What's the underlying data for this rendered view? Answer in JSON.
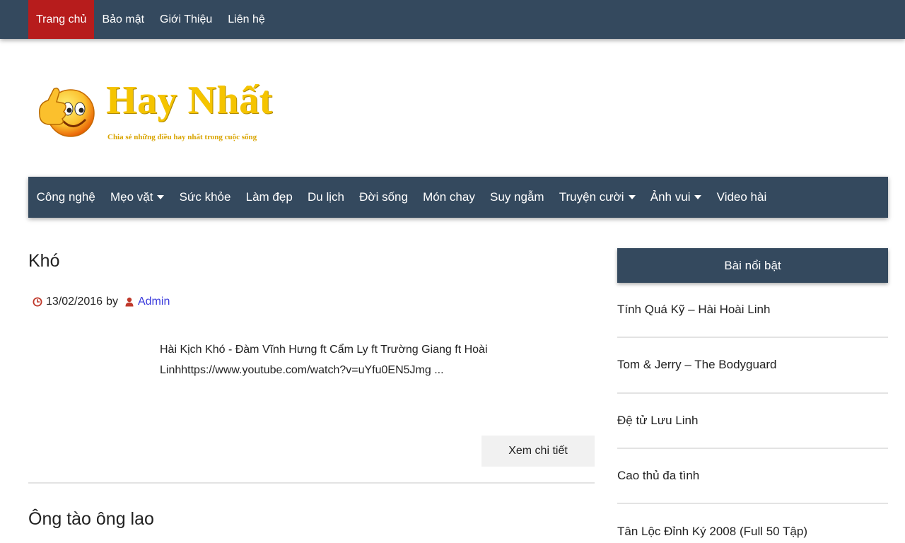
{
  "topnav": {
    "items": [
      {
        "label": "Trang chủ",
        "active": true
      },
      {
        "label": "Bảo mật"
      },
      {
        "label": "Giới Thiệu"
      },
      {
        "label": "Liên hệ"
      }
    ]
  },
  "logo": {
    "title": "Hay Nhất",
    "tagline": "Chia sẻ những điều hay nhất trong cuộc sống"
  },
  "mainnav": {
    "items": [
      {
        "label": "Công nghệ",
        "dropdown": false
      },
      {
        "label": "Mẹo vặt",
        "dropdown": true
      },
      {
        "label": "Sức khỏe",
        "dropdown": false
      },
      {
        "label": "Làm đẹp",
        "dropdown": false
      },
      {
        "label": "Du lịch",
        "dropdown": false
      },
      {
        "label": "Đời sống",
        "dropdown": false
      },
      {
        "label": "Món chay",
        "dropdown": false
      },
      {
        "label": "Suy ngẫm",
        "dropdown": false
      },
      {
        "label": "Truyện cười",
        "dropdown": true
      },
      {
        "label": "Ảnh vui",
        "dropdown": true
      },
      {
        "label": "Video hài",
        "dropdown": false
      }
    ]
  },
  "posts": [
    {
      "title": "Khó",
      "date": "13/02/2016",
      "by": "by",
      "author": "Admin",
      "excerpt": "Hài Kịch Khó - Đàm Vĩnh Hưng ft Cẩm Ly ft Trường Giang ft Hoài Linhhttps://www.youtube.com/watch?v=uYfu0EN5Jmg ...",
      "more_label": "Xem chi tiết"
    },
    {
      "title": "Ông tào ông lao"
    }
  ],
  "sidebar": {
    "widget_title": "Bài nổi bật",
    "items": [
      "Tính Quá Kỹ – Hài Hoài Linh",
      "Tom & Jerry – The Bodyguard",
      "Đệ tử Lưu Linh",
      "Cao thủ đa tình",
      "Tân Lộc Đỉnh Ký 2008 (Full 50 Tập)"
    ]
  },
  "colors": {
    "nav_bg": "#34495e",
    "active_bg": "#b71c1c",
    "logo_yellow": "#f5c400",
    "link_blue": "#3b3bdc",
    "meta_icon_red": "#c0392b"
  },
  "icons": {
    "meta_date": "clock-icon",
    "meta_author": "user-icon",
    "logo": "thumbs-up-smiley-icon"
  }
}
